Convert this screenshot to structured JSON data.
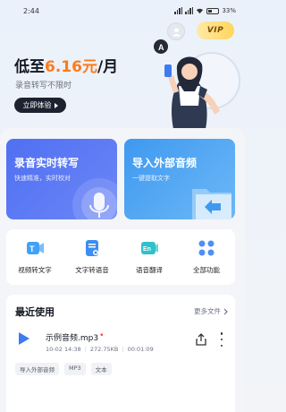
{
  "status_bar": {
    "time": "2:44",
    "battery": "33%"
  },
  "header": {
    "vip_label": "VIP"
  },
  "hero": {
    "title_prefix": "低至",
    "price": "6.16元",
    "title_suffix": "/月",
    "subtitle": "录音转写不限时",
    "cta": "立即体验"
  },
  "feature_cards": [
    {
      "title": "录音实时转写",
      "subtitle": "快速精准，实时校对"
    },
    {
      "title": "导入外部音频",
      "subtitle": "一键提取文字"
    }
  ],
  "tools": [
    {
      "label": "视频转文字",
      "icon": "video-to-text-icon",
      "color": "#3fa2f5"
    },
    {
      "label": "文字转语音",
      "icon": "text-to-speech-icon",
      "color": "#3c8ef2"
    },
    {
      "label": "语音翻译",
      "icon": "voice-translate-icon",
      "color": "#2fc2c9"
    },
    {
      "label": "全部功能",
      "icon": "all-functions-icon",
      "color": "#4d8ff5"
    }
  ],
  "recent": {
    "title": "最近使用",
    "more": "更多文件",
    "file": {
      "name": "示例音频.mp3",
      "date": "10-02 14:38",
      "size": "272.75KB",
      "duration": "00:01:09",
      "tags": [
        "导入外部音频",
        "MP3",
        "文本"
      ]
    }
  }
}
